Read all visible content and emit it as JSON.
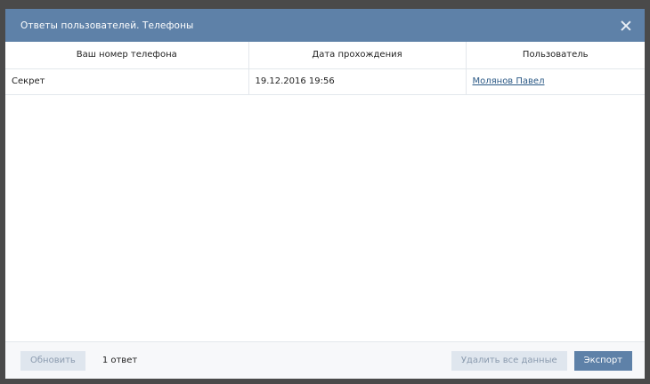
{
  "dialog": {
    "title": "Ответы пользователей. Телефоны"
  },
  "table": {
    "columns": [
      "Ваш номер телефона",
      "Дата прохождения",
      "Пользователь"
    ],
    "rows": [
      {
        "phone": "Секрет",
        "date": "19.12.2016 19:56",
        "user": "Молянов Павел"
      }
    ]
  },
  "footer": {
    "refresh_label": "Обновить",
    "answers_count": "1 ответ",
    "delete_label": "Удалить все данные",
    "export_label": "Экспорт"
  },
  "colors": {
    "header": "#5e81a8",
    "link": "#2a5885",
    "button_grey": "#dfe6ee"
  }
}
